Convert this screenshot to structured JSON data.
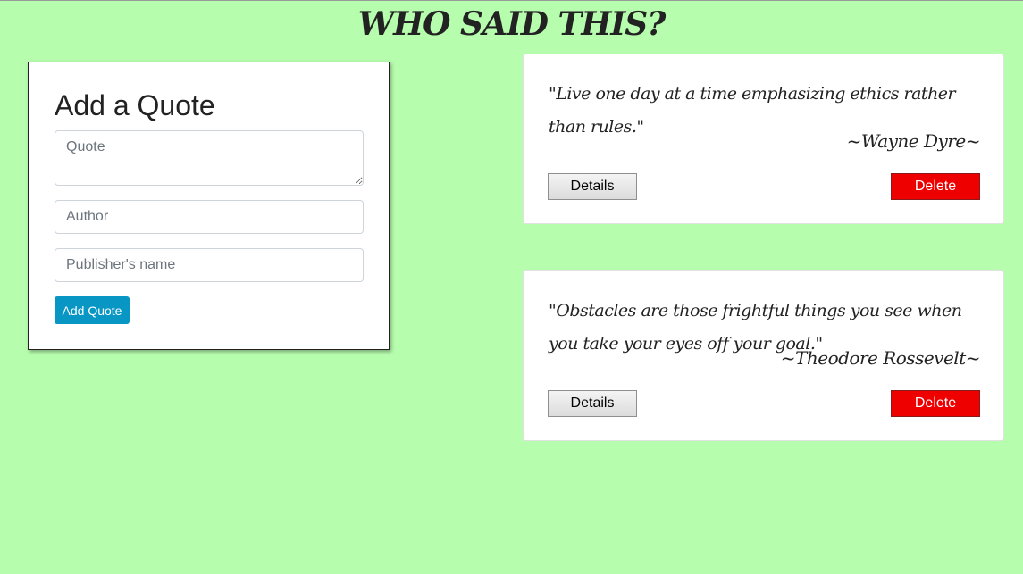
{
  "page": {
    "title": "WHO SAID THIS?",
    "background_color": "#b7fdae"
  },
  "form": {
    "heading": "Add a Quote",
    "quote_placeholder": "Quote",
    "quote_value": "",
    "author_placeholder": "Author",
    "author_value": "",
    "publisher_placeholder": "Publisher's name",
    "publisher_value": "",
    "submit_label": "Add Quote",
    "submit_color": "#0896c4"
  },
  "quotes": [
    {
      "text": "\"Live one day at a time emphasizing ethics rather than rules.\"",
      "author": "~Wayne Dyre~",
      "details_label": "Details",
      "delete_label": "Delete"
    },
    {
      "text": "\"Obstacles are those frightful things you see when you take your eyes off your goal.\"",
      "author": "~Theodore Rossevelt~",
      "details_label": "Details",
      "delete_label": "Delete"
    }
  ],
  "colors": {
    "delete": "#ee0000",
    "card": "#ffffff"
  }
}
